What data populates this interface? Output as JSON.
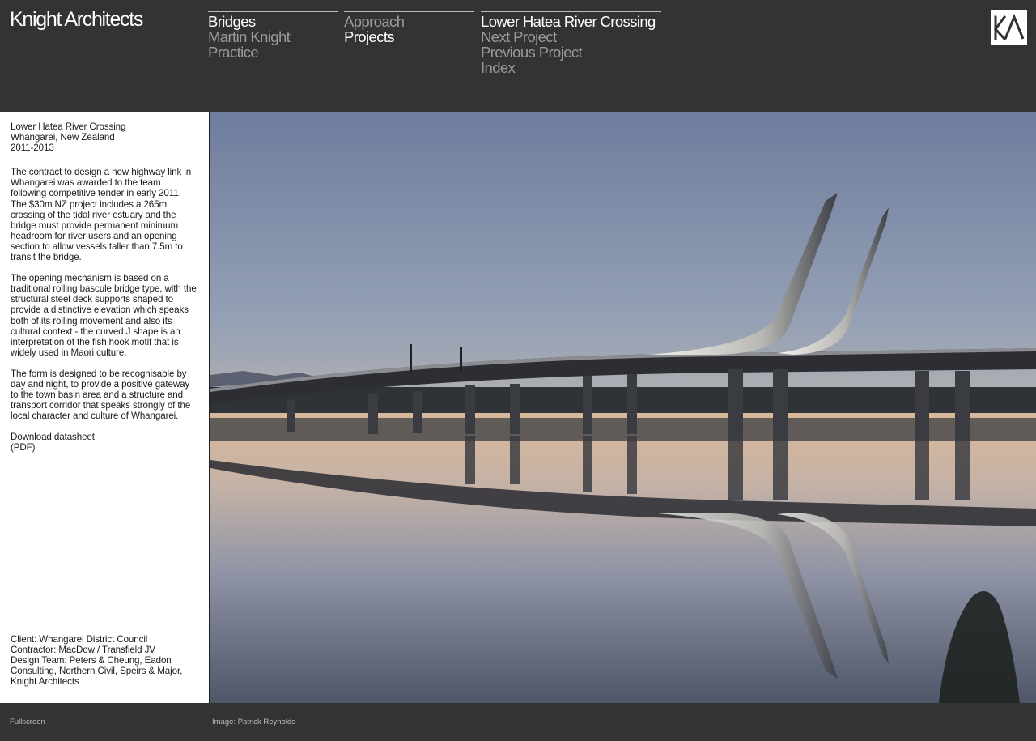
{
  "header": {
    "brand": "Knight Architects",
    "nav_col1": [
      "Bridges",
      "Martin Knight",
      "Practice"
    ],
    "nav_col2": [
      "Approach",
      "Projects"
    ],
    "nav_col3": [
      "Lower Hatea River Crossing",
      "Next Project",
      "Previous Project",
      "Index"
    ],
    "logo_icon": "ka-logo-icon"
  },
  "sidebar": {
    "project_title": "Lower Hatea River Crossing",
    "location": "Whangarei, New Zealand",
    "years": "2011-2013",
    "paragraphs": [
      "The contract to design a new highway link in Whangarei was awarded to the team following competitive tender in early 2011. The $30m NZ project includes a 265m crossing of the tidal river estuary and the bridge must provide permanent minimum headroom for river users and an opening section to allow vessels taller than 7.5m to transit the bridge.",
      "The opening mechanism is based on a traditional rolling bascule  bridge type, with the structural steel deck supports shaped to provide a distinctive elevation which speaks both of its rolling movement and also its cultural context - the curved J shape is an interpretation of the fish hook motif that is widely used in Maori culture.",
      "The form is designed to be recognisable by day and night, to provide a positive gateway to the town basin area and a structure and transport corridor that speaks strongly of the local character and culture of Whangarei."
    ],
    "download_label": "Download datasheet",
    "download_format": "(PDF)",
    "credits": [
      "Client: Whangarei District Council",
      "Contractor: MacDow / Transfield JV",
      "Design Team: Peters & Cheung, Eadon Consulting, Northern Civil, Speirs & Major, Knight Architects"
    ]
  },
  "footer": {
    "fullscreen_label": "Fullscreen",
    "image_credit": "Image: Patrick Reynolds"
  },
  "colors": {
    "background": "#333333",
    "active_nav": "#ffffff",
    "inactive_nav": "#9a9a9a",
    "sidebar_bg": "#ffffff"
  }
}
